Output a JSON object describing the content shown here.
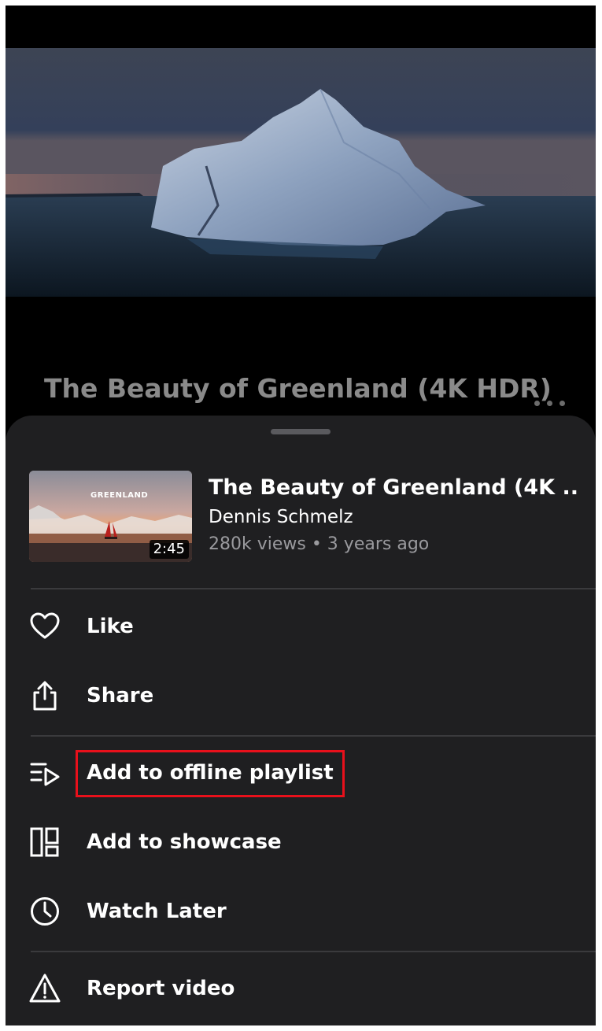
{
  "background": {
    "video_title": "The Beauty of Greenland (4K HDR)"
  },
  "sheet": {
    "video": {
      "title": "The Beauty of Greenland (4K ...",
      "channel": "Dennis Schmelz",
      "stats": "280k views • 3 years ago",
      "duration": "2:45",
      "thumbnail_text": "GREENLAND"
    },
    "menu": [
      {
        "label": "Like",
        "icon": "heart-icon"
      },
      {
        "label": "Share",
        "icon": "share-icon"
      },
      {
        "label": "Add to offline playlist",
        "icon": "playlist-play-icon",
        "highlighted": true
      },
      {
        "label": "Add to showcase",
        "icon": "showcase-layout-icon"
      },
      {
        "label": "Watch Later",
        "icon": "clock-icon"
      },
      {
        "label": "Report video",
        "icon": "warning-icon"
      }
    ]
  },
  "colors": {
    "sheet_background": "#1f1f21",
    "highlight_border": "#e8101b",
    "secondary_text": "#9a9a9e"
  }
}
